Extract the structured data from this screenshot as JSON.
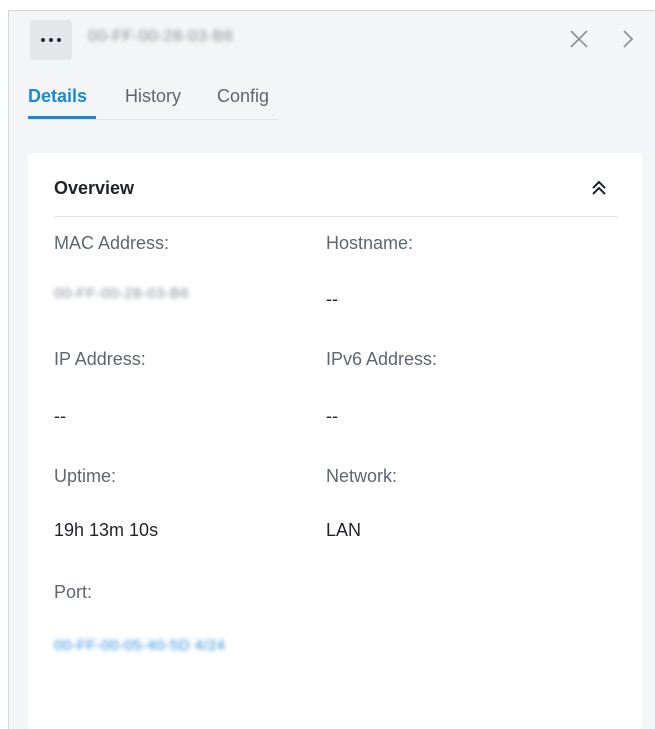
{
  "header": {
    "device_name": "00-FF-00-28-03-B6",
    "more_icon": "more-horizontal-icon",
    "close_icon": "close-icon",
    "next_icon": "chevron-right-icon"
  },
  "tabs": [
    {
      "label": "Details",
      "active": true
    },
    {
      "label": "History",
      "active": false
    },
    {
      "label": "Config",
      "active": false
    }
  ],
  "overview": {
    "title": "Overview",
    "collapse_icon": "double-chevron-up-icon",
    "fields": {
      "mac_address": {
        "label": "MAC Address:",
        "value": "00-FF-00-28-03-B6"
      },
      "hostname": {
        "label": "Hostname:",
        "value": "--"
      },
      "ip_address": {
        "label": "IP Address:",
        "value": "--"
      },
      "ipv6_address": {
        "label": "IPv6 Address:",
        "value": "--"
      },
      "uptime": {
        "label": "Uptime:",
        "value": "19h 13m 10s"
      },
      "network": {
        "label": "Network:",
        "value": "LAN"
      },
      "port": {
        "label": "Port:",
        "value": "00-FF-00-05-40-5D 4/24"
      }
    }
  },
  "colors": {
    "accent": "#1a8bd0",
    "link": "#2c8be0",
    "panel_bg": "#f4f5f7",
    "card_bg": "#ffffff"
  }
}
